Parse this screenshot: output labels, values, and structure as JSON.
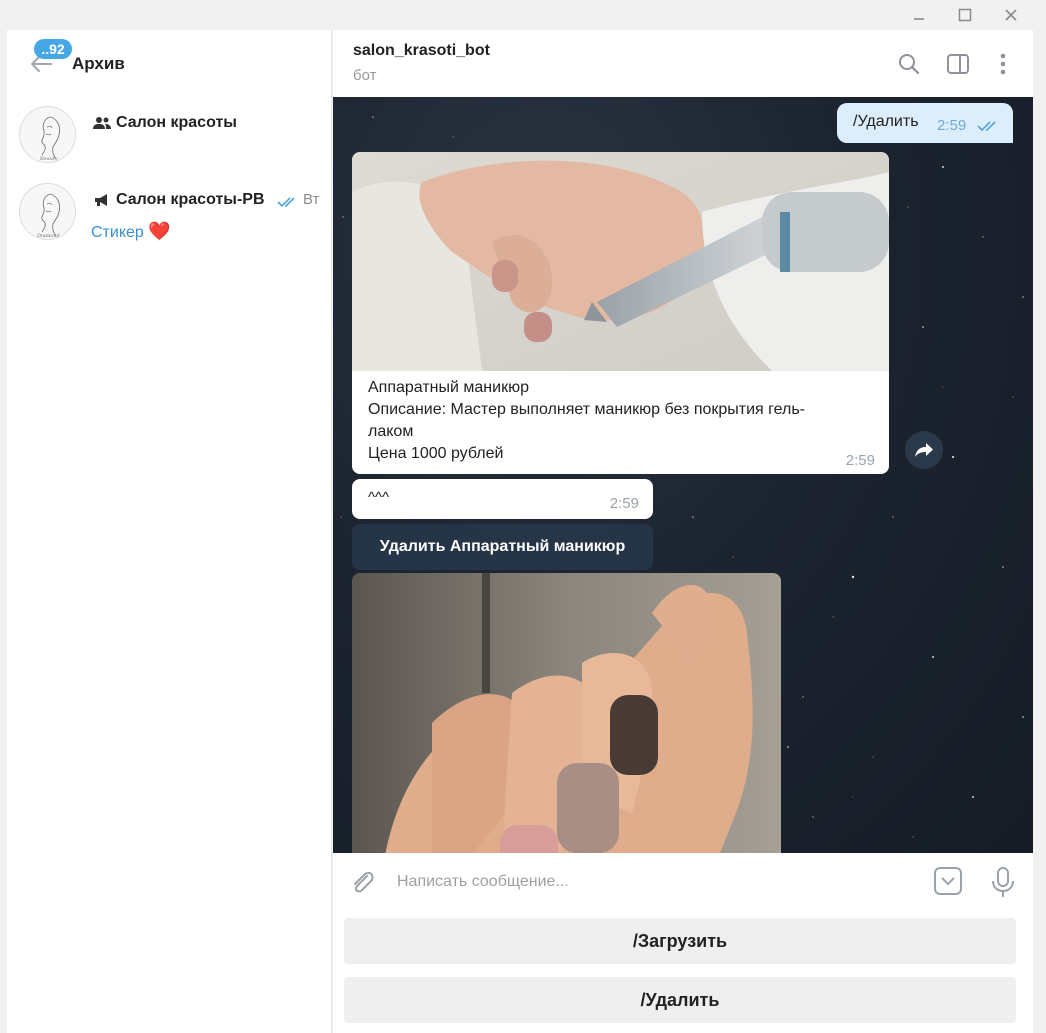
{
  "window": {
    "minimize_icon": "minimize-icon",
    "maximize_icon": "maximize-icon",
    "close_icon": "close-icon"
  },
  "sidebar": {
    "title": "Архив",
    "unread_badge": "..92",
    "chats": [
      {
        "type_icon": "group-icon",
        "name": "Салон красоты",
        "date": "",
        "preview": ""
      },
      {
        "type_icon": "channel-megaphone-icon",
        "name": "Салон красоты-РВ",
        "date": "Вт",
        "preview": "Стикер",
        "preview_emoji": "❤️"
      }
    ]
  },
  "chat": {
    "title": "salon_krasoti_bot",
    "subtitle": "бот",
    "header_icons": [
      "search-icon",
      "sidebar-toggle-icon",
      "more-vertical-icon"
    ],
    "messages": {
      "outgoing": {
        "text": "/Удалить",
        "time": "2:59"
      },
      "card1": {
        "caption": [
          "Аппаратный маникюр",
          "Описание: Мастер выполняет маникюр без покрытия гель-",
          "лаком",
          "Цена 1000 рублей"
        ],
        "time": "2:59"
      },
      "small": {
        "text": "^^^",
        "time": "2:59"
      },
      "inline_button": "Удалить Аппаратный маникюр"
    },
    "composer": {
      "placeholder": "Написать сообщение..."
    },
    "reply_keyboard": [
      "/Загрузить",
      "/Удалить"
    ]
  },
  "colors": {
    "accent": "#45a7e6",
    "outgoing_bubble": "#dceefb",
    "chat_background": "#1c2430",
    "link": "#3a8fd0"
  }
}
